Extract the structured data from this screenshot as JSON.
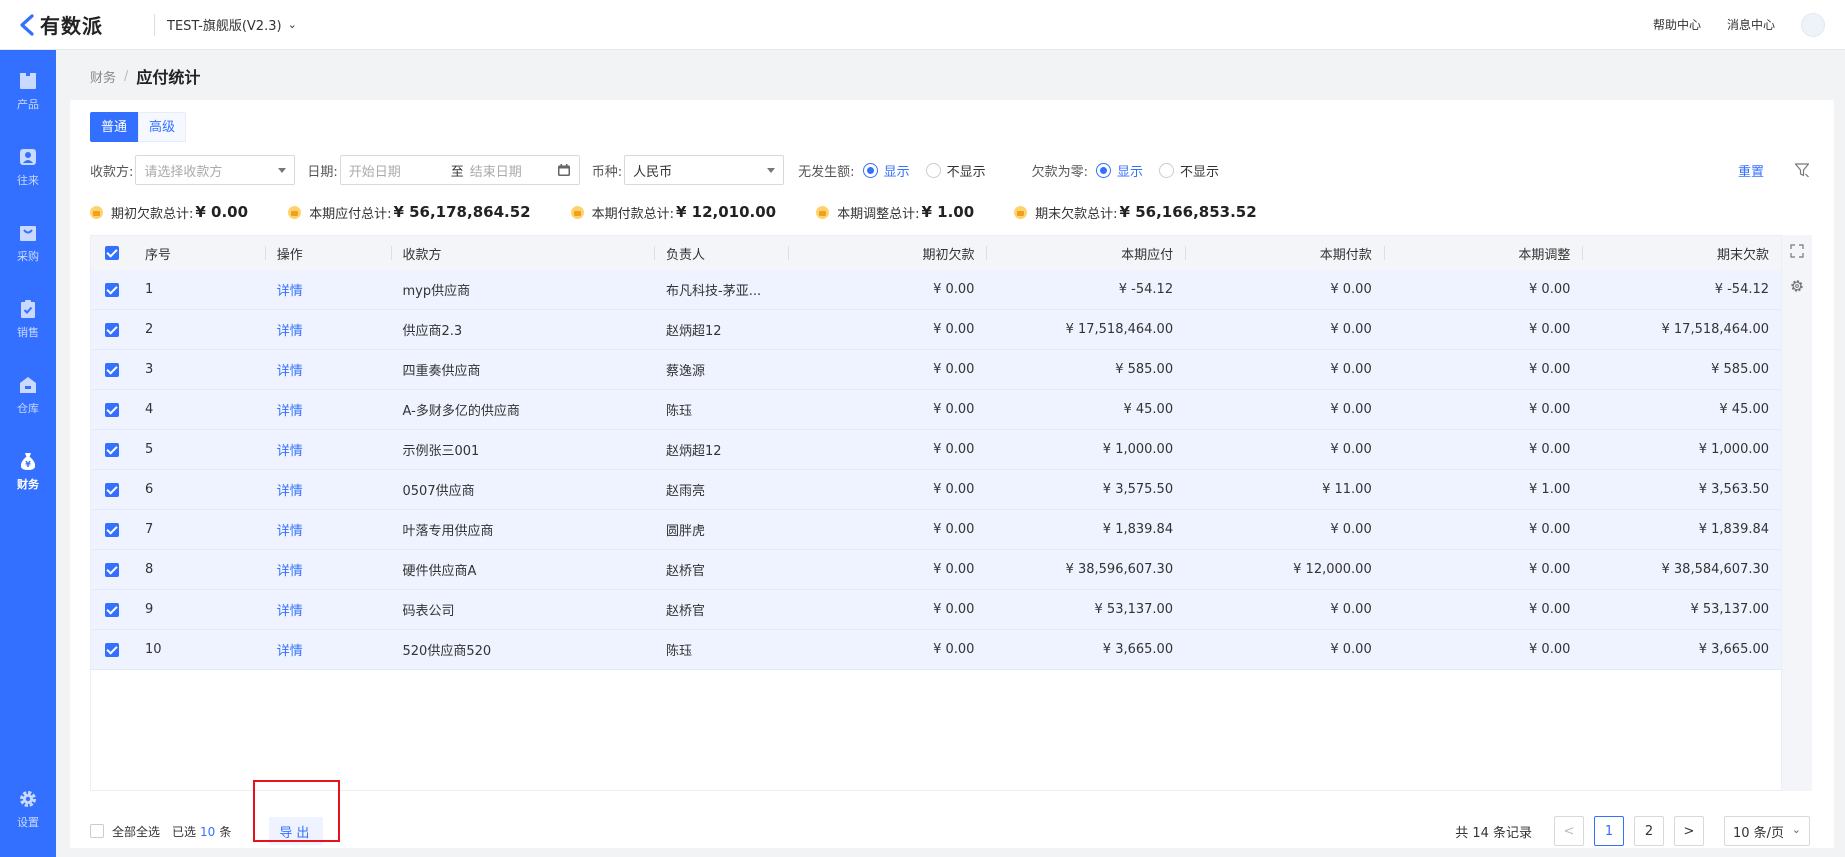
{
  "topbar": {
    "logo_text": "有数派",
    "version": "TEST-旗舰版(V2.3)",
    "help": "帮助中心",
    "messages": "消息中心"
  },
  "sidebar": {
    "items": [
      {
        "label": "产品",
        "icon": "box-icon"
      },
      {
        "label": "往来",
        "icon": "contact-icon"
      },
      {
        "label": "采购",
        "icon": "purchase-icon"
      },
      {
        "label": "销售",
        "icon": "clipboard-icon"
      },
      {
        "label": "仓库",
        "icon": "warehouse-icon"
      },
      {
        "label": "财务",
        "icon": "money-bag-icon",
        "active": true
      },
      {
        "label": "设置",
        "icon": "gear-icon"
      }
    ]
  },
  "breadcrumb": {
    "parent": "财务",
    "sep": "/",
    "current": "应付统计"
  },
  "tabs": [
    "普通",
    "高级"
  ],
  "filters": {
    "payee_label": "收款方:",
    "payee_placeholder": "请选择收款方",
    "date_label": "日期:",
    "date_start": "开始日期",
    "date_to": "至",
    "date_end": "结束日期",
    "currency_label": "币种:",
    "currency_value": "人民币",
    "no_amount_label": "无发生额:",
    "zero_debt_label": "欠款为零:",
    "show": "显示",
    "hide": "不显示",
    "reset": "重置"
  },
  "summary": [
    {
      "label": "期初欠款总计:",
      "value": "¥ 0.00"
    },
    {
      "label": "本期应付总计:",
      "value": "¥ 56,178,864.52"
    },
    {
      "label": "本期付款总计:",
      "value": "¥ 12,010.00"
    },
    {
      "label": "本期调整总计:",
      "value": "¥ 1.00"
    },
    {
      "label": "期末欠款总计:",
      "value": "¥ 56,166,853.52"
    }
  ],
  "table": {
    "headers": [
      "序号",
      "操作",
      "收款方",
      "负责人",
      "期初欠款",
      "本期应付",
      "本期付款",
      "本期调整",
      "期末欠款"
    ],
    "rows": [
      [
        "1",
        "详情",
        "myp供应商",
        "布凡科技-茅亚...",
        "¥ 0.00",
        "¥ -54.12",
        "¥ 0.00",
        "¥ 0.00",
        "¥ -54.12"
      ],
      [
        "2",
        "详情",
        "供应商2.3",
        "赵炳超12",
        "¥ 0.00",
        "¥ 17,518,464.00",
        "¥ 0.00",
        "¥ 0.00",
        "¥ 17,518,464.00"
      ],
      [
        "3",
        "详情",
        "四重奏供应商",
        "蔡逸源",
        "¥ 0.00",
        "¥ 585.00",
        "¥ 0.00",
        "¥ 0.00",
        "¥ 585.00"
      ],
      [
        "4",
        "详情",
        "A-多财多亿的供应商",
        "陈珏",
        "¥ 0.00",
        "¥ 45.00",
        "¥ 0.00",
        "¥ 0.00",
        "¥ 45.00"
      ],
      [
        "5",
        "详情",
        "示例张三001",
        "赵炳超12",
        "¥ 0.00",
        "¥ 1,000.00",
        "¥ 0.00",
        "¥ 0.00",
        "¥ 1,000.00"
      ],
      [
        "6",
        "详情",
        "0507供应商",
        "赵雨亮",
        "¥ 0.00",
        "¥ 3,575.50",
        "¥ 11.00",
        "¥ 1.00",
        "¥ 3,563.50"
      ],
      [
        "7",
        "详情",
        "叶落专用供应商",
        "圆胖虎",
        "¥ 0.00",
        "¥ 1,839.84",
        "¥ 0.00",
        "¥ 0.00",
        "¥ 1,839.84"
      ],
      [
        "8",
        "详情",
        "硬件供应商A",
        "赵桥官",
        "¥ 0.00",
        "¥ 38,596,607.30",
        "¥ 12,000.00",
        "¥ 0.00",
        "¥ 38,584,607.30"
      ],
      [
        "9",
        "详情",
        "码表公司",
        "赵桥官",
        "¥ 0.00",
        "¥ 53,137.00",
        "¥ 0.00",
        "¥ 0.00",
        "¥ 53,137.00"
      ],
      [
        "10",
        "详情",
        "520供应商520",
        "陈珏",
        "¥ 0.00",
        "¥ 3,665.00",
        "¥ 0.00",
        "¥ 0.00",
        "¥ 3,665.00"
      ]
    ]
  },
  "footer": {
    "select_all": "全部全选",
    "selected_prefix": "已选",
    "selected_count": "10",
    "selected_suffix": "条",
    "export": "导出",
    "total": "共 14 条记录",
    "prev": "<",
    "pages": [
      "1",
      "2"
    ],
    "next": ">",
    "page_size": "10 条/页"
  },
  "colors": {
    "brand": "#3370ff",
    "highlight": "#e5141c"
  }
}
